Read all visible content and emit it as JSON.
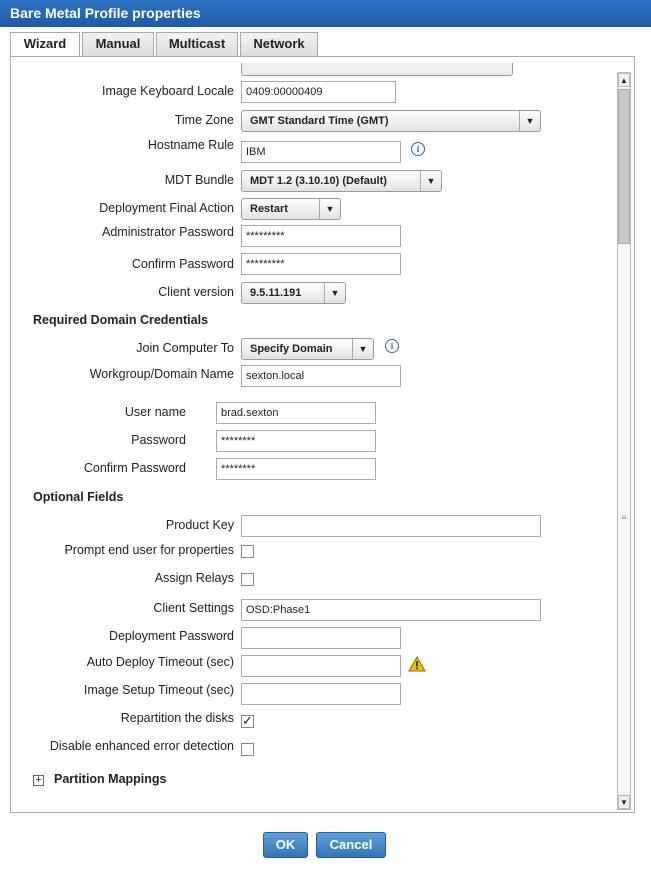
{
  "window": {
    "title": "Bare Metal Profile properties"
  },
  "tabs": [
    {
      "label": "Wizard",
      "active": true
    },
    {
      "label": "Manual",
      "active": false
    },
    {
      "label": "Multicast",
      "active": false
    },
    {
      "label": "Network",
      "active": false
    }
  ],
  "fields": {
    "keyboard_locale": {
      "label": "Image Keyboard Locale",
      "value": "0409:00000409"
    },
    "time_zone": {
      "label": "Time Zone",
      "value": "GMT Standard Time (GMT)"
    },
    "hostname_rule": {
      "label": "Hostname Rule",
      "value": "IBM"
    },
    "mdt_bundle": {
      "label": "MDT Bundle",
      "value": "MDT 1.2 (3.10.10) (Default)"
    },
    "final_action": {
      "label": "Deployment Final Action",
      "value": "Restart"
    },
    "admin_password": {
      "label": "Administrator Password",
      "value": "*********"
    },
    "confirm_password": {
      "label": "Confirm Password",
      "value": "*********"
    },
    "client_version": {
      "label": "Client version",
      "value": "9.5.11.191"
    }
  },
  "domain_section": {
    "title": "Required Domain Credentials",
    "join_to": {
      "label": "Join Computer To",
      "value": "Specify Domain"
    },
    "workgroup": {
      "label": "Workgroup/Domain Name",
      "value": "sexton.local"
    },
    "username": {
      "label": "User name",
      "value": "brad.sexton"
    },
    "password": {
      "label": "Password",
      "value": "********"
    },
    "confirm_password": {
      "label": "Confirm Password",
      "value": "********"
    }
  },
  "optional_section": {
    "title": "Optional Fields",
    "product_key": {
      "label": "Product Key",
      "value": ""
    },
    "prompt_user": {
      "label": "Prompt end user for properties",
      "checked": false
    },
    "assign_relays": {
      "label": "Assign Relays",
      "checked": false
    },
    "client_settings": {
      "label": "Client Settings",
      "value": "OSD:Phase1"
    },
    "deployment_password": {
      "label": "Deployment Password",
      "value": ""
    },
    "auto_deploy_timeout": {
      "label": "Auto Deploy Timeout (sec)",
      "value": ""
    },
    "image_setup_timeout": {
      "label": "Image Setup Timeout (sec)",
      "value": ""
    },
    "repartition": {
      "label": "Repartition the disks",
      "checked": true
    },
    "disable_error_detection": {
      "label": "Disable enhanced error detection",
      "checked": false
    }
  },
  "partition_mappings": {
    "label": "Partition Mappings"
  },
  "buttons": {
    "ok": "OK",
    "cancel": "Cancel"
  },
  "icons": {
    "info": "i",
    "checkmark": "✓",
    "expand": "+",
    "dropdown": "▼"
  },
  "colors": {
    "title_bar": "#2a6bbd",
    "button": "#3f86c8",
    "warning": "#f2c200"
  }
}
